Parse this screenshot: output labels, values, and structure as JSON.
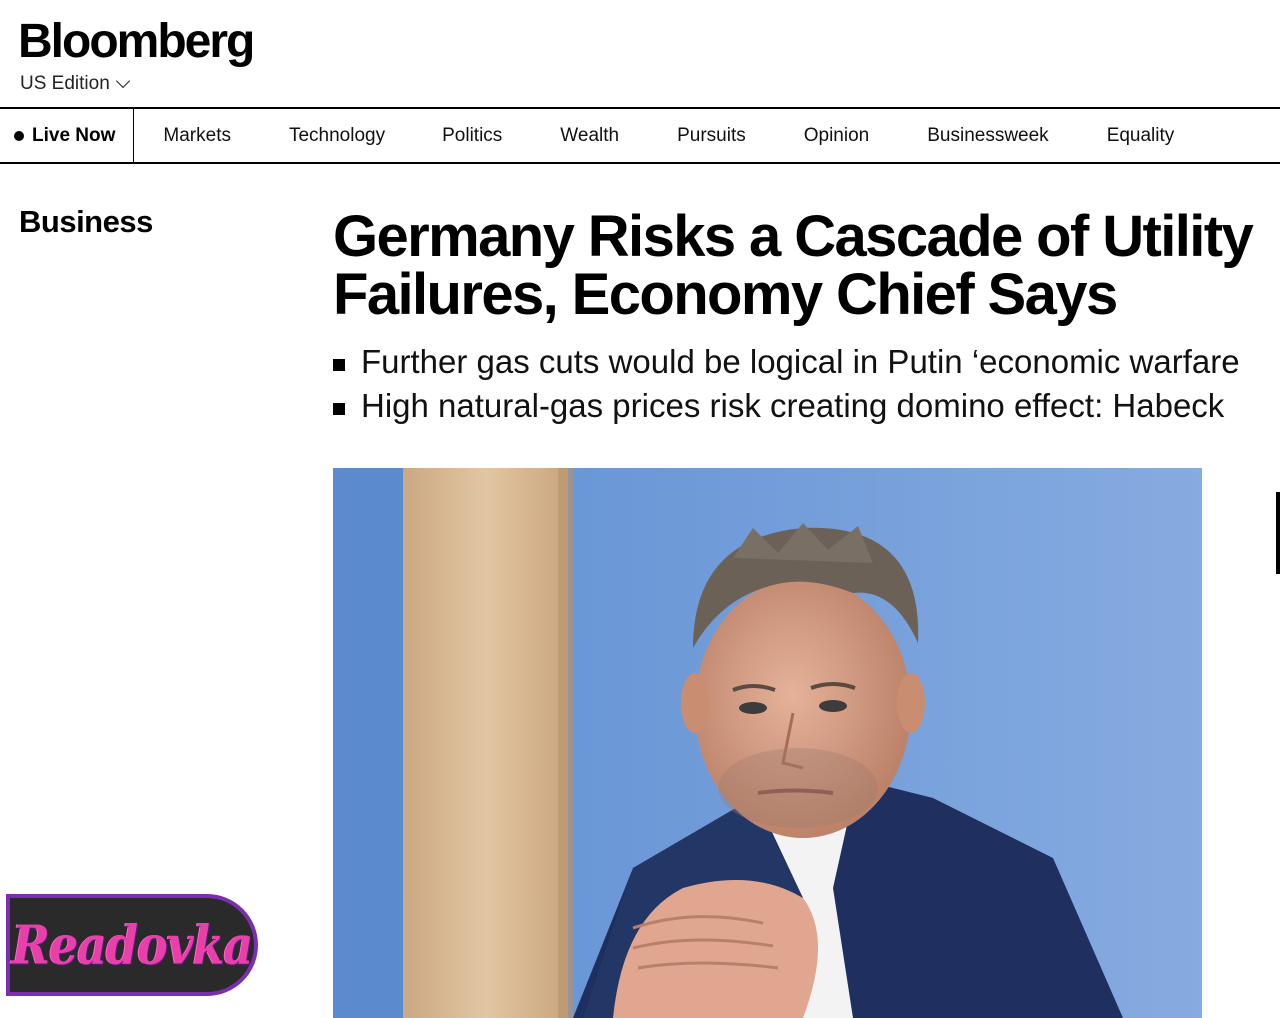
{
  "header": {
    "logo": "Bloomberg",
    "edition": "US Edition"
  },
  "nav": {
    "live_label": "Live Now",
    "items": [
      "Markets",
      "Technology",
      "Politics",
      "Wealth",
      "Pursuits",
      "Opinion",
      "Businessweek",
      "Equality"
    ]
  },
  "article": {
    "section": "Business",
    "headline_line1": "Germany Risks a Cascade of Utility",
    "headline_line2": "Failures, Economy Chief Says",
    "bullets": [
      "Further gas cuts would be logical in Putin ‘economic warfare",
      "High natural-gas prices risk creating domino effect: Habeck"
    ],
    "photo": {
      "subject": "man-in-suit-portrait",
      "background_color": "#6f9ad6"
    }
  },
  "watermark": {
    "text": "Readovka",
    "color": "#e83fa8",
    "border_color": "#7b2fb0"
  }
}
